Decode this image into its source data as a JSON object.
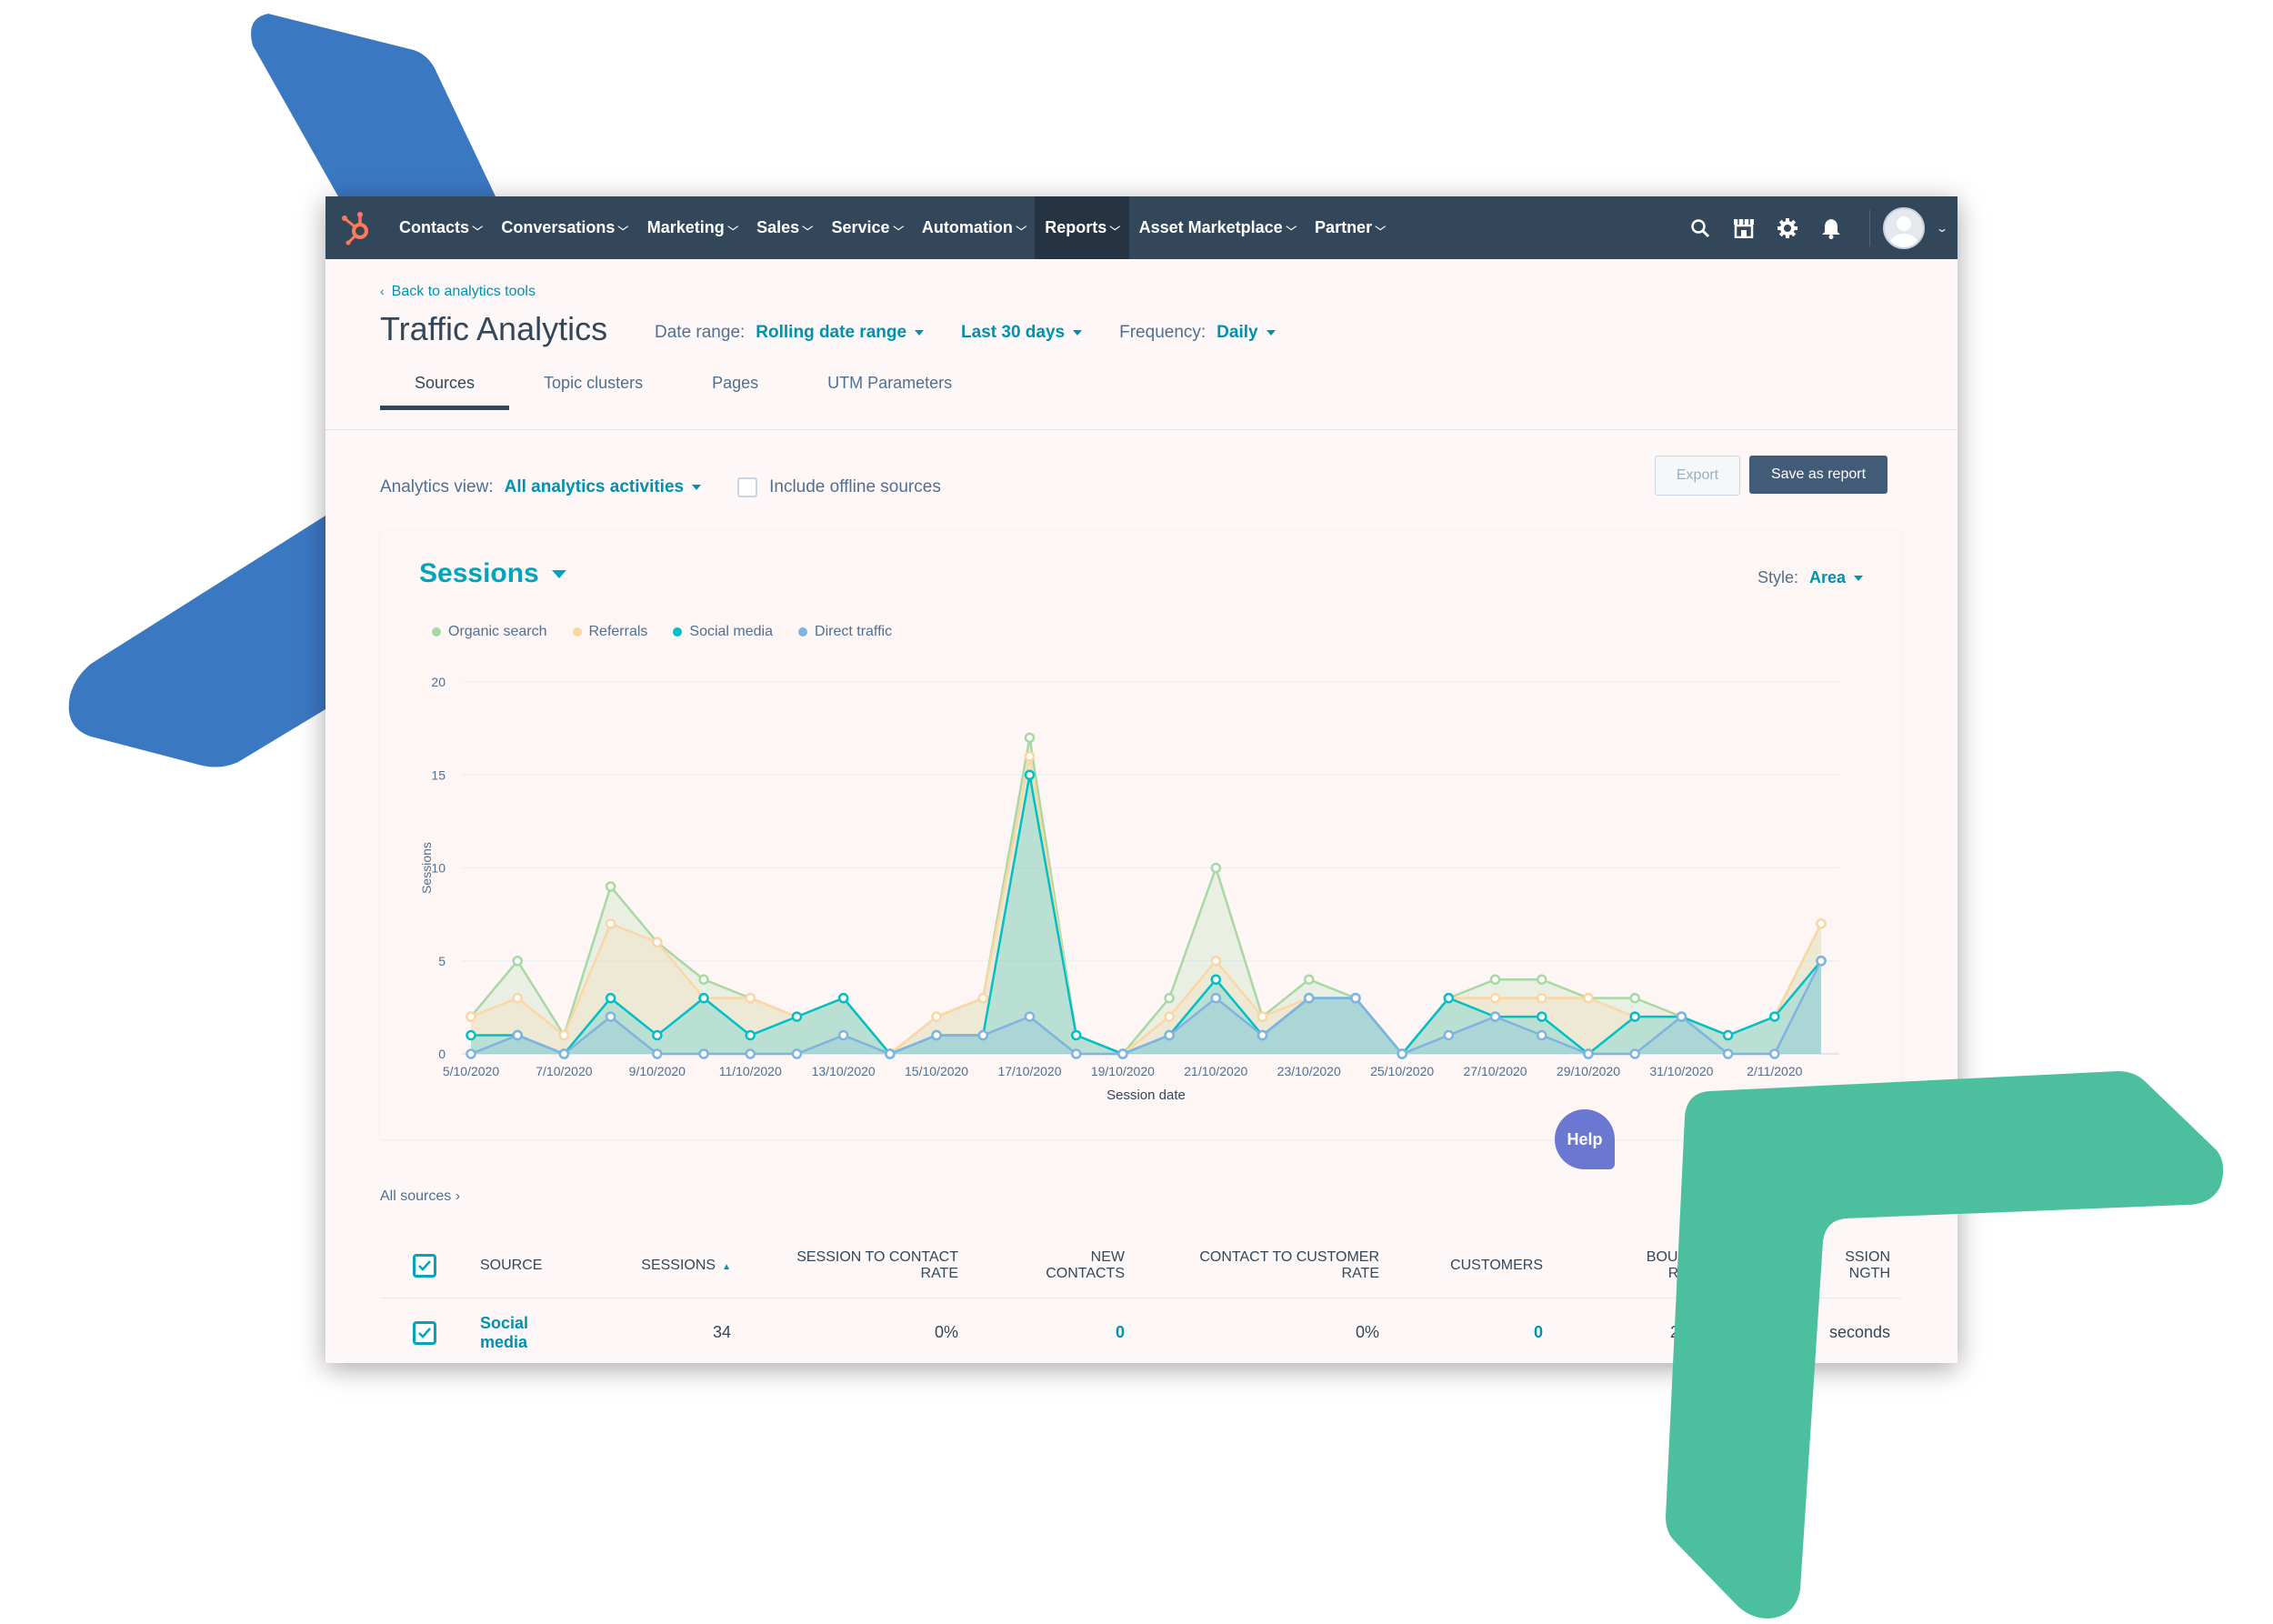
{
  "nav": {
    "items": [
      {
        "label": "Contacts"
      },
      {
        "label": "Conversations"
      },
      {
        "label": "Marketing"
      },
      {
        "label": "Sales"
      },
      {
        "label": "Service"
      },
      {
        "label": "Automation"
      },
      {
        "label": "Reports",
        "active": true
      },
      {
        "label": "Asset Marketplace"
      },
      {
        "label": "Partner"
      }
    ],
    "icons": [
      "search-icon",
      "marketplace-icon",
      "settings-icon",
      "notifications-icon"
    ]
  },
  "header": {
    "back_link": "Back to analytics tools",
    "title": "Traffic Analytics",
    "date_range_label": "Date range:",
    "date_range_value": "Rolling date range",
    "period_value": "Last 30 days",
    "frequency_label": "Frequency:",
    "frequency_value": "Daily"
  },
  "tabs": [
    {
      "label": "Sources",
      "active": true
    },
    {
      "label": "Topic clusters"
    },
    {
      "label": "Pages"
    },
    {
      "label": "UTM Parameters"
    }
  ],
  "view": {
    "label": "Analytics view:",
    "value": "All analytics activities",
    "offline_label": "Include offline sources",
    "export_label": "Export",
    "save_label": "Save as report"
  },
  "chart_card": {
    "title": "Sessions",
    "style_label": "Style:",
    "style_value": "Area"
  },
  "chart_data": {
    "type": "area",
    "xlabel": "Session date",
    "ylabel": "Sessions",
    "ylim": [
      0,
      20
    ],
    "y_ticks": [
      0,
      5,
      10,
      15,
      20
    ],
    "x_tick_labels": [
      "5/10/2020",
      "7/10/2020",
      "9/10/2020",
      "11/10/2020",
      "13/10/2020",
      "15/10/2020",
      "17/10/2020",
      "19/10/2020",
      "21/10/2020",
      "23/10/2020",
      "25/10/2020",
      "27/10/2020",
      "29/10/2020",
      "31/10/2020",
      "2/11/2020"
    ],
    "x": [
      "5/10/2020",
      "6/10/2020",
      "7/10/2020",
      "8/10/2020",
      "9/10/2020",
      "10/10/2020",
      "11/10/2020",
      "12/10/2020",
      "13/10/2020",
      "14/10/2020",
      "15/10/2020",
      "16/10/2020",
      "17/10/2020",
      "18/10/2020",
      "19/10/2020",
      "20/10/2020",
      "21/10/2020",
      "22/10/2020",
      "23/10/2020",
      "24/10/2020",
      "25/10/2020",
      "26/10/2020",
      "27/10/2020",
      "28/10/2020",
      "29/10/2020",
      "30/10/2020",
      "31/10/2020",
      "1/11/2020",
      "2/11/2020",
      "3/11/2020"
    ],
    "series": [
      {
        "name": "Organic search",
        "color": "#a8d8a3",
        "values": [
          2,
          5,
          1,
          9,
          6,
          4,
          3,
          2,
          3,
          0,
          2,
          3,
          17,
          1,
          0,
          3,
          10,
          2,
          4,
          3,
          0,
          3,
          4,
          4,
          3,
          3,
          2,
          1,
          2,
          7
        ]
      },
      {
        "name": "Referrals",
        "color": "#fcd6a4",
        "values": [
          2,
          3,
          1,
          7,
          6,
          3,
          3,
          2,
          3,
          0,
          2,
          3,
          16,
          1,
          0,
          2,
          5,
          2,
          3,
          3,
          0,
          3,
          3,
          3,
          3,
          2,
          2,
          1,
          2,
          7
        ]
      },
      {
        "name": "Social media",
        "color": "#00bfc7",
        "values": [
          1,
          1,
          0,
          3,
          1,
          3,
          1,
          2,
          3,
          0,
          1,
          1,
          15,
          1,
          0,
          1,
          4,
          1,
          3,
          3,
          0,
          3,
          2,
          2,
          0,
          2,
          2,
          1,
          2,
          5
        ]
      },
      {
        "name": "Direct traffic",
        "color": "#7fb3e0",
        "values": [
          0,
          1,
          0,
          2,
          0,
          0,
          0,
          0,
          1,
          0,
          1,
          1,
          2,
          0,
          0,
          1,
          3,
          1,
          3,
          3,
          0,
          1,
          2,
          1,
          0,
          0,
          2,
          0,
          0,
          5
        ]
      }
    ]
  },
  "table": {
    "breadcrumb": "All sources",
    "headers": {
      "source": "SOURCE",
      "sessions": "SESSIONS",
      "session_to_contact_line1": "SESSION TO CONTACT",
      "session_to_contact_line2": "RATE",
      "new_contacts_line1": "NEW",
      "new_contacts_line2": "CONTACTS",
      "contact_to_customer_line1": "CONTACT TO CUSTOMER",
      "contact_to_customer_line2": "RATE",
      "customers": "CUSTOMERS",
      "bounce_line1": "BOUN",
      "bounce_line2": "RA",
      "session_length_line1": "SSION",
      "session_length_line2": "NGTH"
    },
    "rows": [
      {
        "source_line1": "Social",
        "source_line2": "media",
        "sessions": "34",
        "session_to_contact": "0%",
        "new_contacts": "0",
        "contact_to_customer": "0%",
        "customers": "0",
        "bounce": "29",
        "session_length": "seconds"
      }
    ]
  },
  "help_label": "Help",
  "colors": {
    "nav_bg": "#33475b",
    "accent": "#00a4bd",
    "link": "#0091ae",
    "brand_orange": "#ff7a59",
    "deco_blue": "#3b78c2",
    "deco_green": "#4cbf9e"
  }
}
